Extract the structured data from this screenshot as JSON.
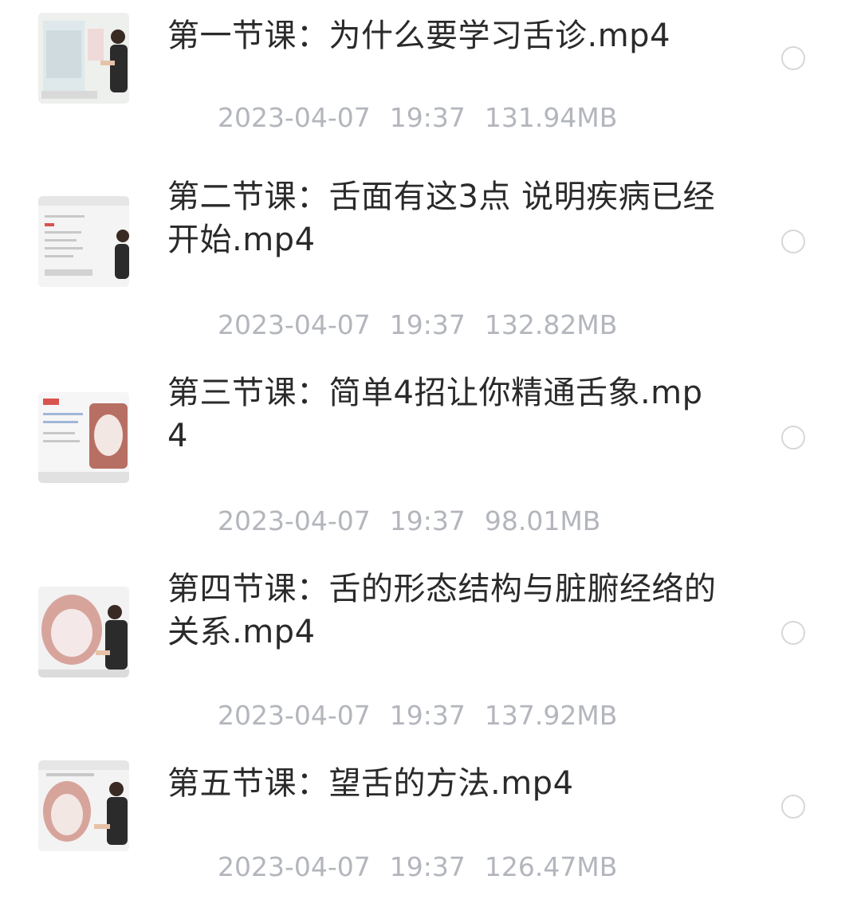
{
  "files": [
    {
      "name": "第一节课：为什么要学习舌诊.mp4",
      "date": "2023-04-07",
      "time": "19:37",
      "size": "131.94MB",
      "thumbnail_icon": "video-thumbnail-icon"
    },
    {
      "name": "第二节课：舌面有这3点 说明疾病已经开始.mp4",
      "date": "2023-04-07",
      "time": "19:37",
      "size": "132.82MB",
      "thumbnail_icon": "video-thumbnail-icon"
    },
    {
      "name": "第三节课：简单4招让你精通舌象.mp4",
      "date": "2023-04-07",
      "time": "19:37",
      "size": "98.01MB",
      "thumbnail_icon": "video-thumbnail-icon"
    },
    {
      "name": "第四节课：舌的形态结构与脏腑经络的关系.mp4",
      "date": "2023-04-07",
      "time": "19:37",
      "size": "137.92MB",
      "thumbnail_icon": "video-thumbnail-icon"
    },
    {
      "name": "第五节课：望舌的方法.mp4",
      "date": "2023-04-07",
      "time": "19:37",
      "size": "126.47MB",
      "thumbnail_icon": "video-thumbnail-icon"
    }
  ],
  "colors": {
    "name_text": "#2a2a2a",
    "meta_text": "#b3b6bc",
    "radio_border": "#d7d7d7"
  }
}
